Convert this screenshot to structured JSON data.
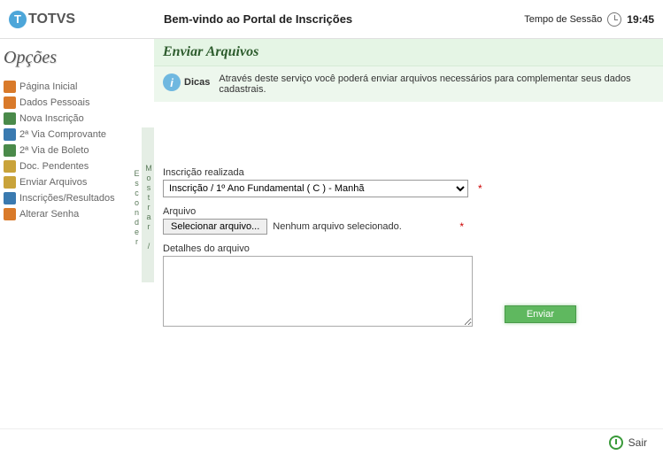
{
  "header": {
    "logo_text": "TOTVS",
    "welcome": "Bem-vindo ao Portal de Inscrições",
    "session_label": "Tempo de Sessão",
    "session_time": "19:45"
  },
  "sidebar": {
    "title": "Opções",
    "items": [
      {
        "label": "Página Inicial",
        "name": "sidebar-item-home",
        "icon": "#d97a2a"
      },
      {
        "label": "Dados Pessoais",
        "name": "sidebar-item-personal",
        "icon": "#d97a2a"
      },
      {
        "label": "Nova Inscrição",
        "name": "sidebar-item-new",
        "icon": "#4a8a4a"
      },
      {
        "label": "2ª Via Comprovante",
        "name": "sidebar-item-receipt",
        "icon": "#3a7ab0"
      },
      {
        "label": "2ª Via de Boleto",
        "name": "sidebar-item-boleto",
        "icon": "#4a8a4a"
      },
      {
        "label": "Doc. Pendentes",
        "name": "sidebar-item-pending",
        "icon": "#c9a33a"
      },
      {
        "label": "Enviar Arquivos",
        "name": "sidebar-item-upload",
        "icon": "#c9a33a"
      },
      {
        "label": "Inscrições/Resultados",
        "name": "sidebar-item-results",
        "icon": "#3a7ab0"
      },
      {
        "label": "Alterar Senha",
        "name": "sidebar-item-password",
        "icon": "#d97a2a"
      }
    ]
  },
  "toggle_label": "Mostrar / Esconder",
  "main": {
    "title": "Enviar Arquivos",
    "info_label": "Dicas",
    "info_text": "Através deste serviço você poderá enviar arquivos necessários para complementar seus dados cadastrais.",
    "field_inscricao_label": "Inscrição realizada",
    "field_inscricao_value": "Inscrição / 1º Ano Fundamental ( C ) - Manhã",
    "field_arquivo_label": "Arquivo",
    "file_button_label": "Selecionar arquivo...",
    "file_status": "Nenhum arquivo selecionado.",
    "field_detalhes_label": "Detalhes do arquivo",
    "required_mark": "*",
    "submit_label": "Enviar"
  },
  "footer": {
    "exit_label": "Sair"
  }
}
